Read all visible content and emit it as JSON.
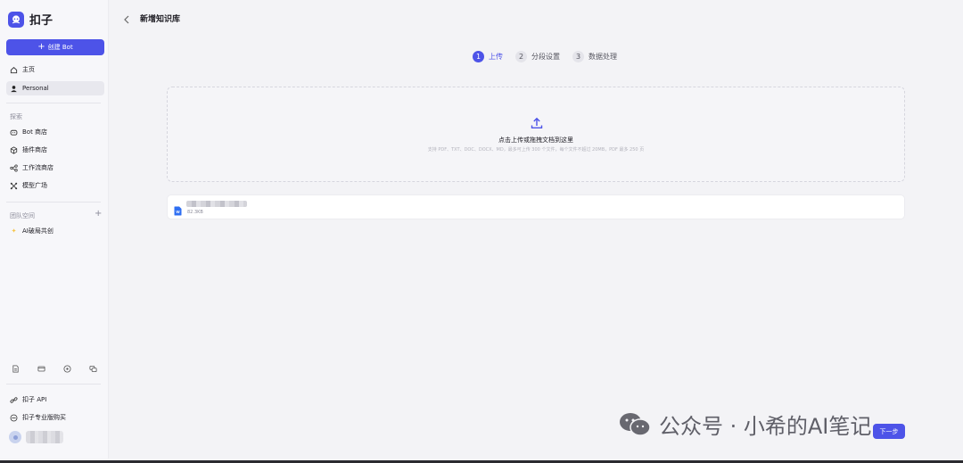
{
  "brand": {
    "name": "扣子"
  },
  "sidebar": {
    "create_label": "创建 Bot",
    "top_items": [
      {
        "label": "主页",
        "icon": "home-icon"
      },
      {
        "label": "Personal",
        "icon": "user-icon"
      }
    ],
    "explore_label": "探索",
    "explore_items": [
      {
        "label": "Bot 商店",
        "icon": "bot-icon"
      },
      {
        "label": "插件商店",
        "icon": "cube-icon"
      },
      {
        "label": "工作流商店",
        "icon": "workflow-icon"
      },
      {
        "label": "模型广场",
        "icon": "model-icon"
      }
    ],
    "team_label": "团队空间",
    "team_add": "+",
    "team_items": [
      {
        "label": "AI破局共创",
        "icon": "spark-icon"
      }
    ],
    "tools": [
      "doc-icon",
      "mail-icon",
      "help-icon",
      "chat-icon"
    ],
    "bottom_items": [
      {
        "label": "扣子 API",
        "icon": "link-icon"
      },
      {
        "label": "扣子专业版购买",
        "icon": "ban-icon"
      }
    ]
  },
  "header": {
    "title": "新增知识库"
  },
  "steps": [
    {
      "num": "1",
      "label": "上传",
      "active": true
    },
    {
      "num": "2",
      "label": "分段设置",
      "active": false
    },
    {
      "num": "3",
      "label": "数据处理",
      "active": false
    }
  ],
  "upload": {
    "title": "点击上传或拖拽文档到这里",
    "hint": "支持 PDF、TXT、DOC、DOCX、MD，最多可上传 300 个文件，每个文件不超过 20MB，PDF 最多 250 页"
  },
  "file": {
    "size": "82.3KB",
    "type_icon": "word-icon"
  },
  "next_button": "下一步",
  "watermark": {
    "text": "公众号 · 小希的AI笔记"
  },
  "colors": {
    "accent": "#4d53e8",
    "background": "#f3f3f6",
    "sidebar": "#f7f7fa"
  }
}
